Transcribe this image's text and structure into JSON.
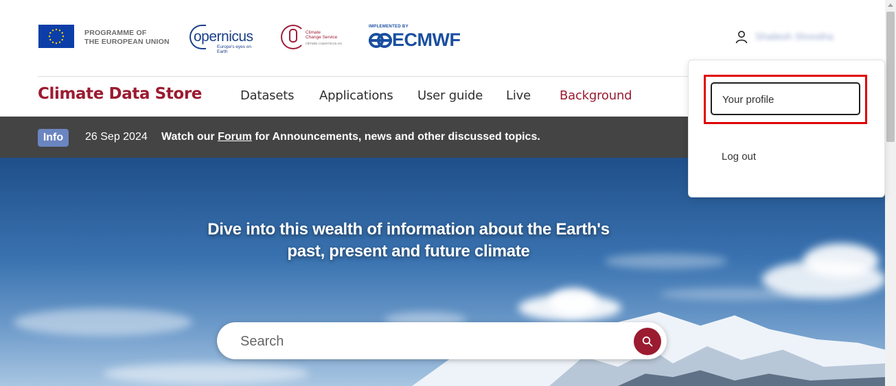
{
  "header": {
    "eu_programme": [
      "PROGRAMME OF",
      "THE EUROPEAN UNION"
    ],
    "copernicus": {
      "name": "opernicus",
      "tagline": "Europe's eyes on Earth"
    },
    "c3s": {
      "line1": "Climate",
      "line2": "Change Service",
      "url": "climate.copernicus.eu"
    },
    "ecmwf": {
      "implemented_by": "IMPLEMENTED BY",
      "name": "ECMWF"
    },
    "user": {
      "icon": "user-icon",
      "name": "Shailesh Shrestha"
    }
  },
  "nav": {
    "site_title": "Climate Data Store",
    "items": [
      {
        "label": "Datasets"
      },
      {
        "label": "Applications"
      },
      {
        "label": "User guide"
      },
      {
        "label": "Live"
      },
      {
        "label": "Background"
      }
    ],
    "active_color": "#9b1b30"
  },
  "info": {
    "badge": "Info",
    "date": "26 Sep 2024",
    "message_prefix": "Watch our",
    "link_text": "Forum",
    "message_suffix": "for Announcements, news and other discussed topics."
  },
  "hero": {
    "title_line1": "Dive into this wealth of information about the Earth's",
    "title_line2": "past, present and future climate"
  },
  "search": {
    "placeholder": "Search",
    "icon": "search-icon"
  },
  "user_menu": {
    "items": [
      {
        "label": "Your profile"
      },
      {
        "label": "Log out"
      }
    ]
  },
  "colors": {
    "brand": "#9b1b30",
    "info_bar": "#444444",
    "badge": "#6a85c0",
    "highlight": "#e00000"
  }
}
